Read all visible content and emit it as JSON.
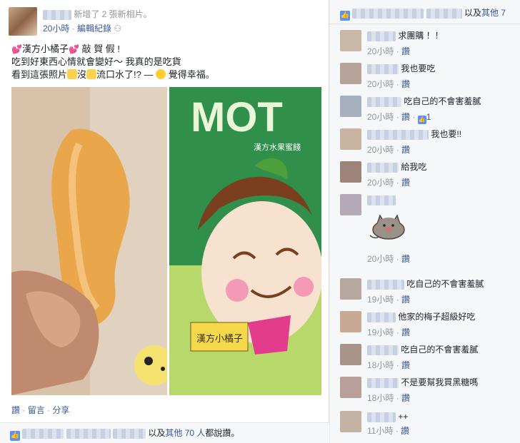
{
  "post": {
    "action": "新增了 2 張新相片。",
    "time": "20小時",
    "edited": "編輯紀錄",
    "line1_name": "漢方小橘子",
    "line1_rest": " 敲 賀 假 !",
    "line2": "吃到好東西心情就會變好～ 我真的是吃貨",
    "line3a": "看到這張照片",
    "line3b": "沒",
    "line3c": "流口水了!? — ",
    "feeling": "覺得幸福。",
    "photo_label": "漢方小橘子",
    "photo_brand": "MOT",
    "photo_caption": "漢方水果蜜餞"
  },
  "actions": {
    "like": "讚",
    "comment": "留言",
    "share": "分享"
  },
  "likes_footer": {
    "others": "其他 70 人",
    "text": "都說讚。",
    "prefix": "以及"
  },
  "right_likes": {
    "prefix": "以及",
    "others": "其他 7"
  },
  "comments": [
    {
      "text": "求團購 ！！",
      "time": "20小時",
      "like": "讚",
      "likes": ""
    },
    {
      "text": "我也要吃",
      "time": "20小時",
      "like": "讚",
      "likes": ""
    },
    {
      "text": "吃自己的不會害羞膩",
      "time": "20小時",
      "like": "讚",
      "likes": "1"
    },
    {
      "text": "我也要!!",
      "time": "20小時",
      "like": "讚",
      "likes": ""
    },
    {
      "text": "給我吃",
      "time": "20小時",
      "like": "讚",
      "likes": ""
    },
    {
      "text": "",
      "time": "20小時",
      "like": "讚",
      "likes": ""
    },
    {
      "text": "吃自己的不會害羞膩",
      "time": "19小時",
      "like": "讚",
      "likes": ""
    },
    {
      "text": "他家的梅子超級好吃",
      "time": "19小時",
      "like": "讚",
      "likes": ""
    },
    {
      "text": "吃自己的不會害羞膩",
      "time": "18小時",
      "like": "讚",
      "likes": ""
    },
    {
      "text": "不是要幫我買黑糖嗎",
      "time": "18小時",
      "like": "讚",
      "likes": ""
    },
    {
      "text": "++",
      "time": "11小時",
      "like": "讚",
      "likes": ""
    }
  ],
  "colors": {
    "link": "#3b5998",
    "meta": "#90949c",
    "like_blue": "#5890ff"
  }
}
